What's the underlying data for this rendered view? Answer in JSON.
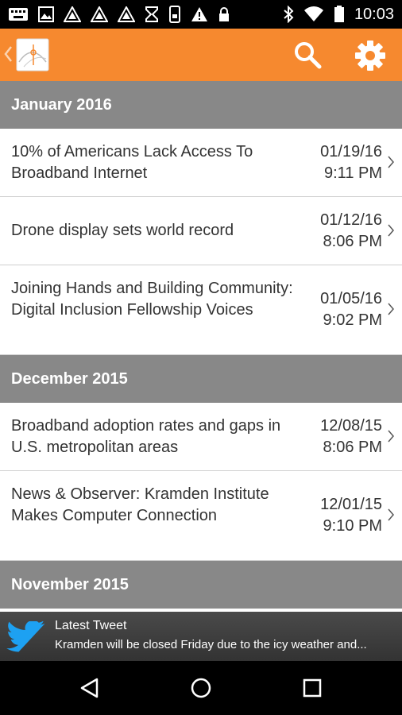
{
  "status_bar": {
    "time": "10:03",
    "left_icons": [
      "keyboard-icon",
      "image-icon",
      "warning-triangle-icon",
      "warning-triangle-icon",
      "warning-triangle-icon",
      "hourglass-icon",
      "phone-lock-icon",
      "alert-icon",
      "lock-icon"
    ],
    "right_icons": [
      "bluetooth-icon",
      "wifi-icon",
      "battery-icon"
    ]
  },
  "action_bar": {
    "color": "#f6892f",
    "back_icon": "chevron-left-icon",
    "logo_icon": "app-logo-icon",
    "search_icon": "search-icon",
    "settings_icon": "gear-icon"
  },
  "sections": [
    {
      "header": "January 2016",
      "items": [
        {
          "title": "10% of Americans Lack Access To Broadband Internet",
          "date": "01/19/16",
          "time": "9:11 PM"
        },
        {
          "title": "Drone display sets world record",
          "date": "01/12/16",
          "time": "8:06 PM"
        },
        {
          "title": "Joining Hands and Building Community: Digital Inclusion Fellowship Voices",
          "date": "01/05/16",
          "time": "9:02 PM"
        }
      ]
    },
    {
      "header": "December 2015",
      "items": [
        {
          "title": "Broadband adoption rates and gaps in U.S. metropolitan areas",
          "date": "12/08/15",
          "time": "8:06 PM"
        },
        {
          "title": "News & Observer: Kramden Institute Makes Computer Connection",
          "date": "12/01/15",
          "time": "9:10 PM"
        }
      ]
    },
    {
      "header": "November 2015",
      "items": []
    }
  ],
  "tweet": {
    "title": "Latest Tweet",
    "text": "Kramden will be closed Friday due to the icy weather and...",
    "icon": "twitter-bird-icon",
    "color": "#1da1f2"
  },
  "nav_bar": {
    "icons": [
      "back-triangle-icon",
      "home-circle-icon",
      "recents-square-icon"
    ]
  }
}
